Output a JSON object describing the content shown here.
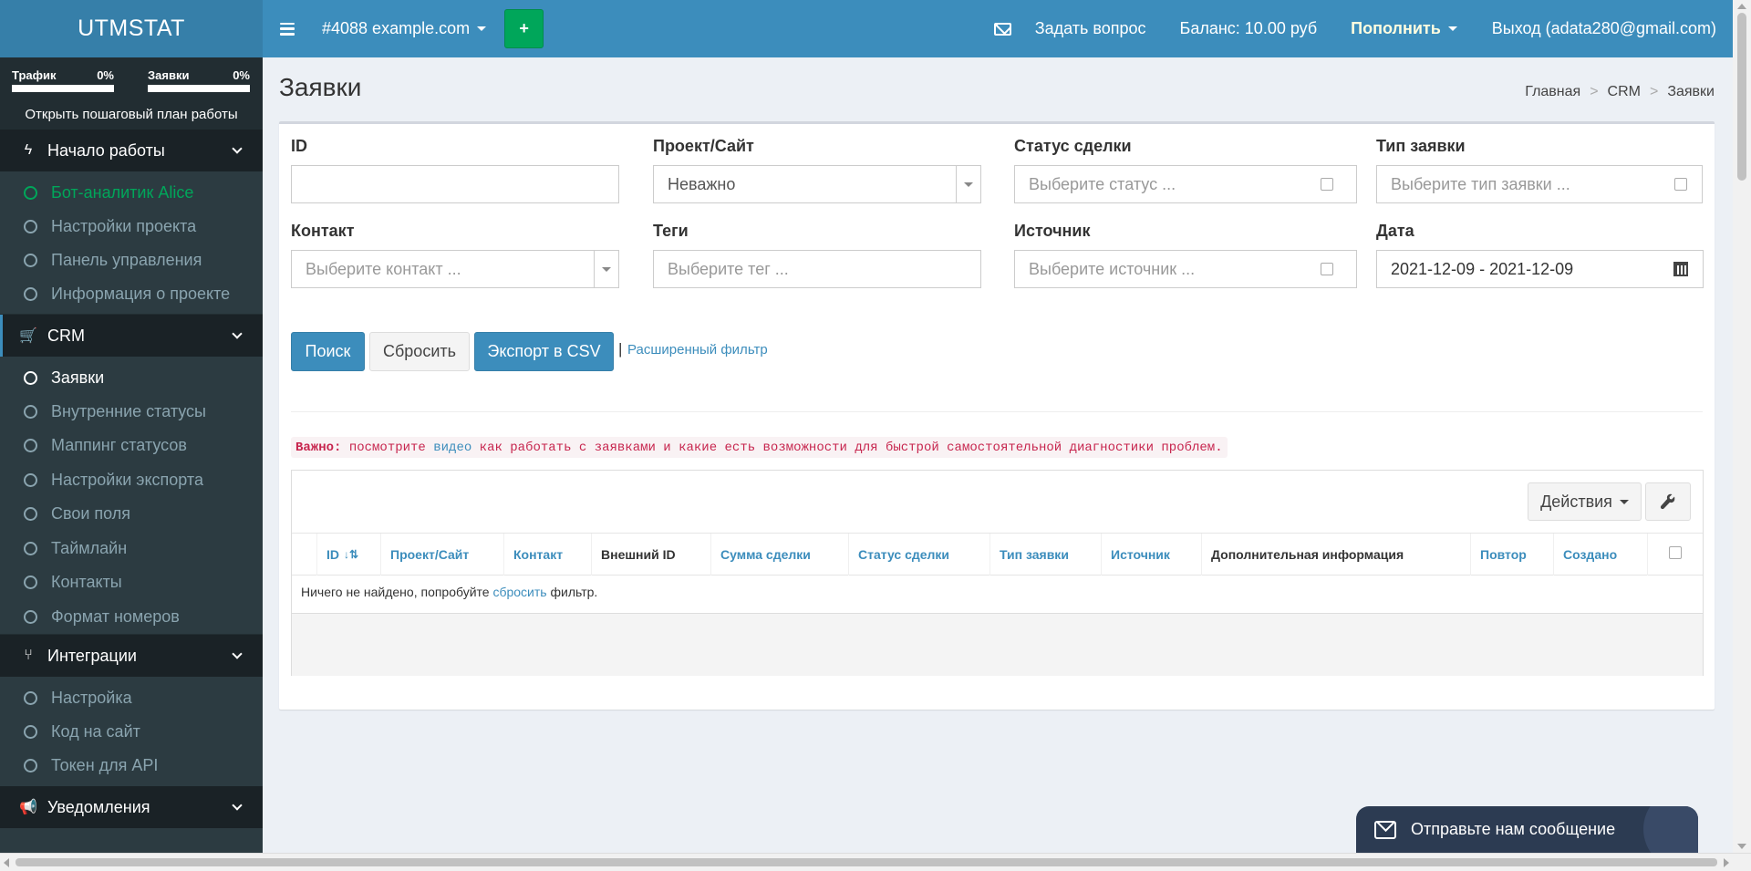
{
  "header": {
    "logo": "UTMSTAT",
    "project": "#4088 example.com",
    "add_label": "+",
    "ask": "Задать вопрос",
    "balance": "Баланс: 10.00 руб",
    "topup": "Пополнить",
    "logout": "Выход (adata280@gmail.com)"
  },
  "sidebar": {
    "traffic_label": "Трафик",
    "traffic_pct": "0%",
    "leads_label": "Заявки",
    "leads_pct": "0%",
    "plan_link": "Открыть пошаговый план работы",
    "sections": [
      {
        "label": "Начало работы",
        "icon": "bolt-icon",
        "items": [
          "Бот-аналитик Alice",
          "Настройки проекта",
          "Панель управления",
          "Информация о проекте"
        ]
      },
      {
        "label": "CRM",
        "icon": "cart-icon",
        "items": [
          "Заявки",
          "Внутренние статусы",
          "Маппинг статусов",
          "Настройки экспорта",
          "Свои поля",
          "Таймлайн",
          "Контакты",
          "Формат номеров"
        ]
      },
      {
        "label": "Интеграции",
        "icon": "branch-icon",
        "items": [
          "Настройка",
          "Код на сайт",
          "Токен для API"
        ]
      },
      {
        "label": "Уведомления",
        "icon": "bullhorn-icon",
        "items": []
      }
    ]
  },
  "page": {
    "title": "Заявки",
    "breadcrumb": [
      "Главная",
      "CRM",
      "Заявки"
    ]
  },
  "filters": {
    "id_label": "ID",
    "id_value": "",
    "project_label": "Проект/Сайт",
    "project_value": "Неважно",
    "status_label": "Статус сделки",
    "status_placeholder": "Выберите статус ...",
    "type_label": "Тип заявки",
    "type_placeholder": "Выберите тип заявки ...",
    "contact_label": "Контакт",
    "contact_placeholder": "Выберите контакт ...",
    "tags_label": "Теги",
    "tags_placeholder": "Выберите тег ...",
    "source_label": "Источник",
    "source_placeholder": "Выберите источник ...",
    "date_label": "Дата",
    "date_value": "2021-12-09 - 2021-12-09"
  },
  "buttons": {
    "search": "Поиск",
    "reset": "Сбросить",
    "export": "Экспорт в CSV",
    "separator": "|",
    "advanced": "Расширенный фильтр"
  },
  "notice": {
    "bold": "Важно:",
    "before": " посмотрите ",
    "link": "видео",
    "after": " как работать с заявками и какие есть возможности для быстрой самостоятельной диагностики проблем."
  },
  "table": {
    "actions": "Действия",
    "columns": [
      "ID",
      "Проект/Сайт",
      "Контакт",
      "Внешний ID",
      "Сумма сделки",
      "Статус сделки",
      "Тип заявки",
      "Источник",
      "Дополнительная информация",
      "Повтор",
      "Создано"
    ],
    "empty_before": "Ничего не найдено, попробуйте ",
    "empty_link": "сбросить",
    "empty_after": " фильтр."
  },
  "chat": {
    "label": "Отправьте нам сообщение"
  },
  "colors": {
    "header": "#3c8dbc",
    "logo": "#367fa9",
    "sidebar": "#222d32",
    "accent_green": "#00a65a"
  }
}
